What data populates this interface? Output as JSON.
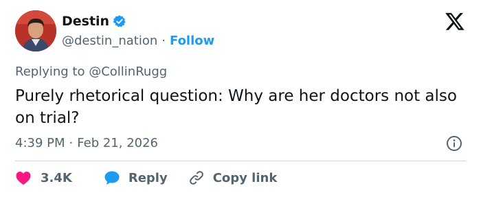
{
  "author": {
    "name": "Destin",
    "handle": "@destin_nation",
    "separator": "·",
    "follow_label": "Follow"
  },
  "reply_context": {
    "prefix": "Replying to",
    "mention": "@CollinRugg"
  },
  "tweet": {
    "text": "Purely rhetorical question: Why are her doctors not also on trial?",
    "time": "4:39 PM",
    "separator": "·",
    "date": "Feb 21, 2026"
  },
  "actions": {
    "likes": "3.4K",
    "reply_label": "Reply",
    "copy_label": "Copy link"
  },
  "colors": {
    "accent": "#1d9bf0",
    "like": "#f91880",
    "muted": "#536471",
    "text": "#0f1419",
    "divider": "#cfd9de"
  },
  "icons": [
    "verified-badge-icon",
    "x-logo-icon",
    "info-icon",
    "heart-icon",
    "reply-bubble-icon",
    "link-icon"
  ]
}
